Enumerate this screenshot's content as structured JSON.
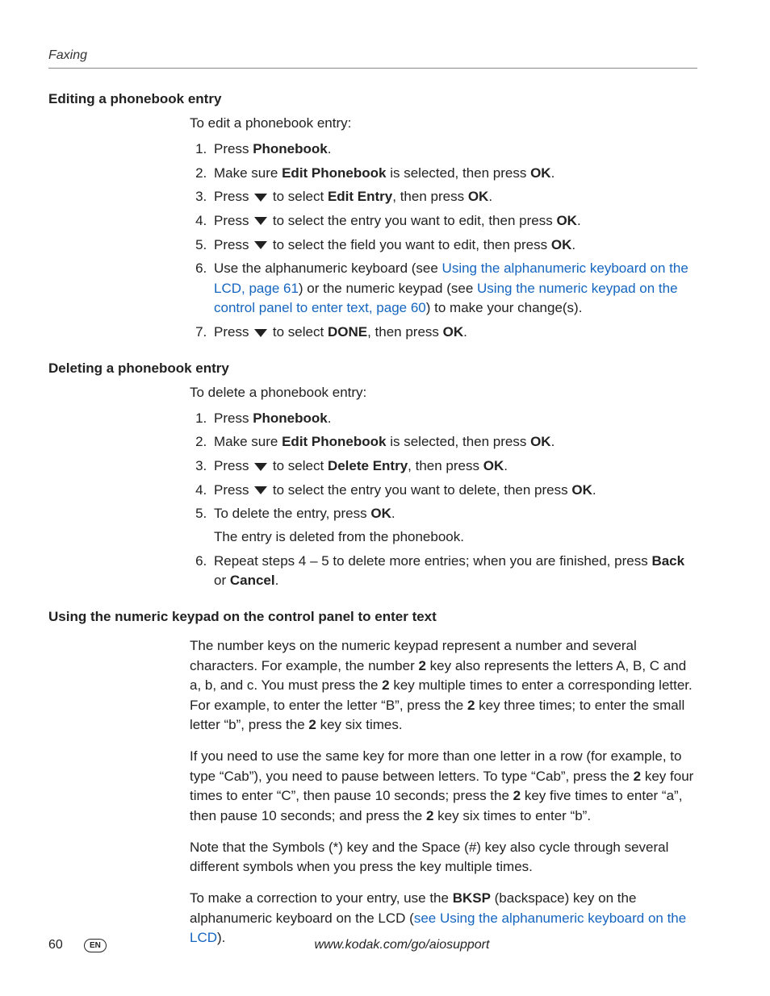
{
  "header": {
    "running": "Faxing"
  },
  "sections": {
    "edit": {
      "title": "Editing a phonebook entry",
      "intro": "To edit a phonebook entry:",
      "s1a": "Press ",
      "s1b": "Phonebook",
      "s1c": ".",
      "s2a": "Make sure ",
      "s2b": "Edit Phonebook",
      "s2c": " is selected, then press ",
      "s2d": "OK",
      "s2e": ".",
      "s3a": "Press ",
      "s3b": " to select ",
      "s3c": "Edit Entry",
      "s3d": ", then press ",
      "s3e": "OK",
      "s3f": ".",
      "s4a": "Press ",
      "s4b": " to select the entry you want to edit, then press ",
      "s4c": "OK",
      "s4d": ".",
      "s5a": "Press ",
      "s5b": " to select the field you want to edit, then press ",
      "s5c": "OK",
      "s5d": ".",
      "s6a": "Use the alphanumeric keyboard (see ",
      "s6link1": "Using the alphanumeric keyboard on the LCD, page 61",
      "s6b": ") or the numeric keypad (see ",
      "s6link2": "Using the numeric keypad on the control panel to enter text, page 60",
      "s6c": ") to make your change(s).",
      "s7a": "Press ",
      "s7b": " to select ",
      "s7c": "DONE",
      "s7d": ", then press ",
      "s7e": "OK",
      "s7f": "."
    },
    "delete": {
      "title": "Deleting a phonebook entry",
      "intro": "To delete a phonebook entry:",
      "s1a": "Press ",
      "s1b": "Phonebook",
      "s1c": ".",
      "s2a": "Make sure ",
      "s2b": "Edit Phonebook",
      "s2c": " is selected, then press ",
      "s2d": "OK",
      "s2e": ".",
      "s3a": "Press ",
      "s3b": " to select ",
      "s3c": "Delete Entry",
      "s3d": ", then press ",
      "s3e": "OK",
      "s3f": ".",
      "s4a": "Press ",
      "s4b": " to select the entry you want to delete, then press ",
      "s4c": "OK",
      "s4d": ".",
      "s5a": "To delete the entry, press ",
      "s5b": "OK",
      "s5c": ".",
      "s5sub": "The entry is deleted from the phonebook.",
      "s6a": "Repeat steps 4 – 5 to delete more entries; when you are finished, press ",
      "s6b": "Back",
      "s6c": " or ",
      "s6d": "Cancel",
      "s6e": "."
    },
    "keypad": {
      "title": "Using the numeric keypad on the control panel to enter text",
      "p1a": "The number keys on the numeric keypad represent a number and several characters. For example, the number ",
      "p1b": "2",
      "p1c": " key also represents the letters A, B, C and a, b, and c. You must press the ",
      "p1d": "2",
      "p1e": " key multiple times to enter a corresponding letter. For example, to enter the letter “B”, press the ",
      "p1f": "2",
      "p1g": " key three times; to enter the small letter “b”, press the ",
      "p1h": "2",
      "p1i": " key six times.",
      "p2a": "If you need to use the same key for more than one letter in a row (for example, to type “Cab”), you need to pause between letters. To type “Cab”, press the ",
      "p2b": "2",
      "p2c": " key four times to enter “C”, then pause 10 seconds; press the ",
      "p2d": "2",
      "p2e": " key five times to enter “a”, then pause 10 seconds; and press the ",
      "p2f": "2",
      "p2g": " key six times to enter “b”.",
      "p3": "Note that the Symbols (*) key and the Space (#) key also cycle through several different symbols when you press the key multiple times.",
      "p4a": "To make a correction to your entry, use the ",
      "p4b": "BKSP",
      "p4c": " (backspace) key on the alphanumeric keyboard on the LCD (",
      "p4link": "see Using the alphanumeric keyboard on the LCD",
      "p4d": ")."
    }
  },
  "footer": {
    "page": "60",
    "lang": "EN",
    "url": "www.kodak.com/go/aiosupport"
  }
}
